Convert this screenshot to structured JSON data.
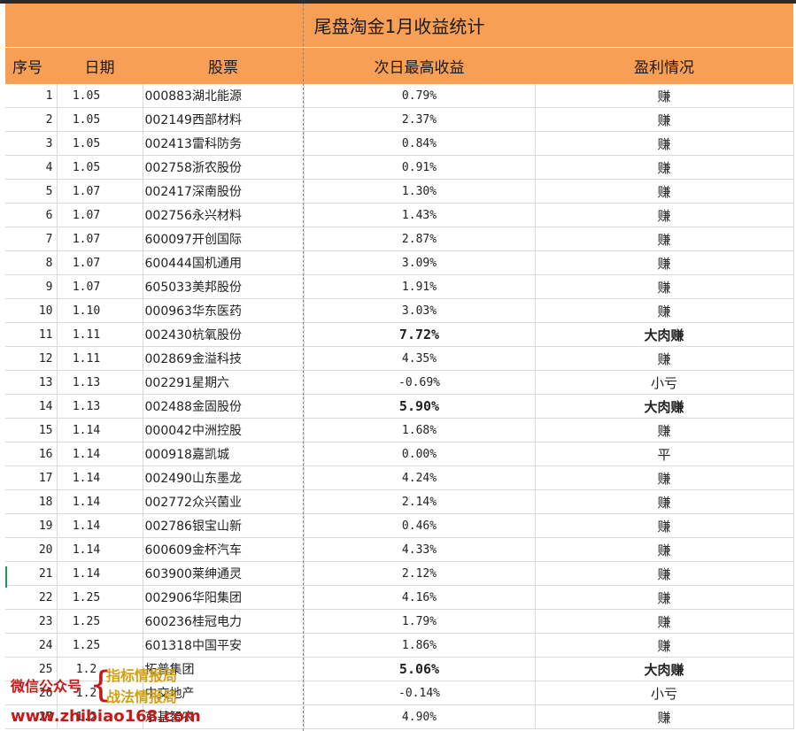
{
  "title": "尾盘淘金1月收益统计",
  "headers": [
    "序号",
    "日期",
    "股票",
    "次日最高收益",
    "盈利情况"
  ],
  "rows": [
    {
      "idx": "1",
      "date": "1.05",
      "stock": "000883湖北能源",
      "gain": "0.79%",
      "result": "赚"
    },
    {
      "idx": "2",
      "date": "1.05",
      "stock": "002149西部材料",
      "gain": "2.37%",
      "result": "赚"
    },
    {
      "idx": "3",
      "date": "1.05",
      "stock": "002413雷科防务",
      "gain": "0.84%",
      "result": "赚"
    },
    {
      "idx": "4",
      "date": "1.05",
      "stock": "002758浙农股份",
      "gain": "0.91%",
      "result": "赚"
    },
    {
      "idx": "5",
      "date": "1.07",
      "stock": "002417深南股份",
      "gain": "1.30%",
      "result": "赚"
    },
    {
      "idx": "6",
      "date": "1.07",
      "stock": "002756永兴材料",
      "gain": "1.43%",
      "result": "赚"
    },
    {
      "idx": "7",
      "date": "1.07",
      "stock": "600097开创国际",
      "gain": "2.87%",
      "result": "赚"
    },
    {
      "idx": "8",
      "date": "1.07",
      "stock": "600444国机通用",
      "gain": "3.09%",
      "result": "赚"
    },
    {
      "idx": "9",
      "date": "1.07",
      "stock": "605033美邦股份",
      "gain": "1.91%",
      "result": "赚"
    },
    {
      "idx": "10",
      "date": "1.10",
      "stock": "000963华东医药",
      "gain": "3.03%",
      "result": "赚"
    },
    {
      "idx": "11",
      "date": "1.11",
      "stock": "002430杭氧股份",
      "gain": "7.72%",
      "result": "大肉赚"
    },
    {
      "idx": "12",
      "date": "1.11",
      "stock": "002869金溢科技",
      "gain": "4.35%",
      "result": "赚"
    },
    {
      "idx": "13",
      "date": "1.13",
      "stock": "002291星期六",
      "gain": "-0.69%",
      "result": "小亏"
    },
    {
      "idx": "14",
      "date": "1.13",
      "stock": "002488金固股份",
      "gain": "5.90%",
      "result": "大肉赚"
    },
    {
      "idx": "15",
      "date": "1.14",
      "stock": "000042中洲控股",
      "gain": "1.68%",
      "result": "赚"
    },
    {
      "idx": "16",
      "date": "1.14",
      "stock": "000918嘉凯城",
      "gain": "0.00%",
      "result": "平"
    },
    {
      "idx": "17",
      "date": "1.14",
      "stock": "002490山东墨龙",
      "gain": "4.24%",
      "result": "赚"
    },
    {
      "idx": "18",
      "date": "1.14",
      "stock": "002772众兴菌业",
      "gain": "2.14%",
      "result": "赚"
    },
    {
      "idx": "19",
      "date": "1.14",
      "stock": "002786银宝山新",
      "gain": "0.46%",
      "result": "赚"
    },
    {
      "idx": "20",
      "date": "1.14",
      "stock": "600609金杯汽车",
      "gain": "4.33%",
      "result": "赚"
    },
    {
      "idx": "21",
      "date": "1.14",
      "stock": "603900莱绅通灵",
      "gain": "2.12%",
      "result": "赚"
    },
    {
      "idx": "22",
      "date": "1.25",
      "stock": "002906华阳集团",
      "gain": "4.16%",
      "result": "赚"
    },
    {
      "idx": "23",
      "date": "1.25",
      "stock": "600236桂冠电力",
      "gain": "1.79%",
      "result": "赚"
    },
    {
      "idx": "24",
      "date": "1.25",
      "stock": "601318中国平安",
      "gain": "1.86%",
      "result": "赚"
    },
    {
      "idx": "25",
      "date": "1.2",
      "stock": "拓普集团",
      "gain": "5.06%",
      "result": "大肉赚"
    },
    {
      "idx": "26",
      "date": "1.2",
      "stock": "中交地产",
      "gain": "-0.14%",
      "result": "小亏"
    },
    {
      "idx": "27",
      "date": "1.2",
      "stock": "京基智农",
      "gain": "4.90%",
      "result": "赚"
    }
  ],
  "watermark": {
    "wechat": "微信公众号",
    "brace": "{",
    "line1": "指标情报局",
    "line2": "战法情报局",
    "url": "www.zhibiao168.com"
  },
  "colors": {
    "header_bg": "#f79f55",
    "profit_red": "#d40000",
    "loss_green": "#1a9a5e"
  }
}
